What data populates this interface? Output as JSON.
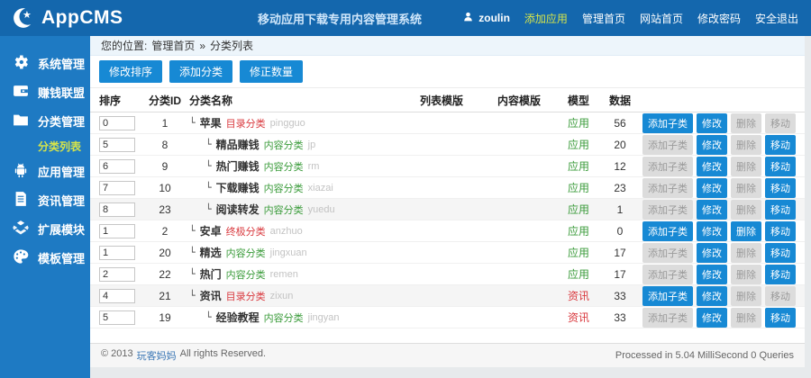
{
  "header": {
    "logo": "AppCMS",
    "subtitle": "移动应用下载专用内容管理系统",
    "user": "zoulin",
    "nav": [
      {
        "label": "添加应用",
        "highlight": true
      },
      {
        "label": "管理首页",
        "highlight": false
      },
      {
        "label": "网站首页",
        "highlight": false
      },
      {
        "label": "修改密码",
        "highlight": false
      },
      {
        "label": "安全退出",
        "highlight": false
      }
    ]
  },
  "sidebar": {
    "items": [
      {
        "label": "系统管理",
        "icon": "gear-icon"
      },
      {
        "label": "赚钱联盟",
        "icon": "wallet-icon"
      },
      {
        "label": "分类管理",
        "icon": "folder-icon",
        "active": true
      },
      {
        "label": "应用管理",
        "icon": "android-icon"
      },
      {
        "label": "资讯管理",
        "icon": "news-icon"
      },
      {
        "label": "扩展模块",
        "icon": "box-icon"
      },
      {
        "label": "模板管理",
        "icon": "palette-icon"
      }
    ],
    "submenu": {
      "label": "分类列表",
      "active": true
    }
  },
  "breadcrumb": {
    "prefix": "您的位置:",
    "home": "管理首页",
    "separator": "»",
    "current": "分类列表"
  },
  "toolbar": {
    "buttons": [
      "修改排序",
      "添加分类",
      "修正数量"
    ]
  },
  "table": {
    "headers": [
      "排序",
      "分类ID",
      "分类名称",
      "列表模版",
      "内容模版",
      "模型",
      "数据"
    ],
    "action_labels": {
      "add_child": "添加子类",
      "edit": "修改",
      "delete": "删除",
      "move": "移动"
    },
    "rows": [
      {
        "sort": "0",
        "id": "1",
        "name": "苹果",
        "type": "目录分类",
        "type_color": "red",
        "pinyin": "pingguo",
        "level": 1,
        "model": "应用",
        "model_color": "green",
        "count": "56",
        "shaded": false,
        "actions": {
          "add_child": true,
          "edit": true,
          "delete": false,
          "move": false
        }
      },
      {
        "sort": "5",
        "id": "8",
        "name": "精品赚钱",
        "type": "内容分类",
        "type_color": "green",
        "pinyin": "jp",
        "level": 2,
        "model": "应用",
        "model_color": "green",
        "count": "20",
        "shaded": false,
        "actions": {
          "add_child": false,
          "edit": true,
          "delete": false,
          "move": true
        }
      },
      {
        "sort": "6",
        "id": "9",
        "name": "热门赚钱",
        "type": "内容分类",
        "type_color": "green",
        "pinyin": "rm",
        "level": 2,
        "model": "应用",
        "model_color": "green",
        "count": "12",
        "shaded": false,
        "actions": {
          "add_child": false,
          "edit": true,
          "delete": false,
          "move": true
        }
      },
      {
        "sort": "7",
        "id": "10",
        "name": "下载赚钱",
        "type": "内容分类",
        "type_color": "green",
        "pinyin": "xiazai",
        "level": 2,
        "model": "应用",
        "model_color": "green",
        "count": "23",
        "shaded": false,
        "actions": {
          "add_child": false,
          "edit": true,
          "delete": false,
          "move": true
        }
      },
      {
        "sort": "8",
        "id": "23",
        "name": "阅读转发",
        "type": "内容分类",
        "type_color": "green",
        "pinyin": "yuedu",
        "level": 2,
        "model": "应用",
        "model_color": "green",
        "count": "1",
        "shaded": true,
        "actions": {
          "add_child": false,
          "edit": true,
          "delete": false,
          "move": true
        }
      },
      {
        "sort": "1",
        "id": "2",
        "name": "安卓",
        "type": "终极分类",
        "type_color": "red",
        "pinyin": "anzhuo",
        "level": 1,
        "model": "应用",
        "model_color": "green",
        "count": "0",
        "shaded": false,
        "actions": {
          "add_child": true,
          "edit": true,
          "delete": true,
          "move": true
        }
      },
      {
        "sort": "1",
        "id": "20",
        "name": "精选",
        "type": "内容分类",
        "type_color": "green",
        "pinyin": "jingxuan",
        "level": 1,
        "model": "应用",
        "model_color": "green",
        "count": "17",
        "shaded": false,
        "actions": {
          "add_child": false,
          "edit": true,
          "delete": false,
          "move": true
        }
      },
      {
        "sort": "2",
        "id": "22",
        "name": "热门",
        "type": "内容分类",
        "type_color": "green",
        "pinyin": "remen",
        "level": 1,
        "model": "应用",
        "model_color": "green",
        "count": "17",
        "shaded": false,
        "actions": {
          "add_child": false,
          "edit": true,
          "delete": false,
          "move": true
        }
      },
      {
        "sort": "4",
        "id": "21",
        "name": "资讯",
        "type": "目录分类",
        "type_color": "red",
        "pinyin": "zixun",
        "level": 1,
        "model": "资讯",
        "model_color": "red",
        "count": "33",
        "shaded": true,
        "actions": {
          "add_child": true,
          "edit": true,
          "delete": false,
          "move": false
        }
      },
      {
        "sort": "5",
        "id": "19",
        "name": "经验教程",
        "type": "内容分类",
        "type_color": "green",
        "pinyin": "jingyan",
        "level": 2,
        "model": "资讯",
        "model_color": "red",
        "count": "33",
        "shaded": false,
        "actions": {
          "add_child": false,
          "edit": true,
          "delete": false,
          "move": true
        }
      }
    ]
  },
  "footer": {
    "copyright_prefix": "© 2013",
    "copyright_link": "玩客妈妈",
    "copyright_suffix": "All rights Reserved.",
    "processed": "Processed in 5.04 MilliSecond 0 Queries"
  },
  "colors": {
    "header_bg": "#1467ad",
    "sidebar_bg": "#1e7ac3",
    "accent_blue": "#1789d4",
    "highlight_yellow": "#d6e44a",
    "type_red": "#d9383d",
    "type_green": "#3a9b3a",
    "disabled_grey": "#dcdcdc"
  }
}
